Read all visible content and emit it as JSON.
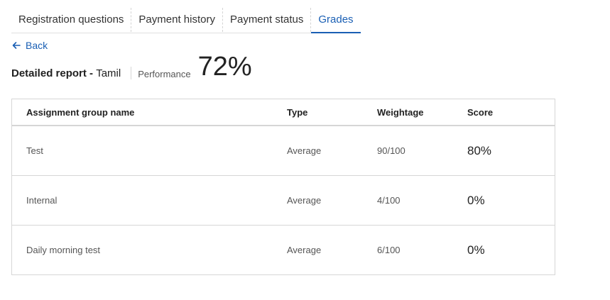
{
  "tabs": [
    {
      "label": "Registration questions"
    },
    {
      "label": "Payment history"
    },
    {
      "label": "Payment status"
    },
    {
      "label": "Grades"
    }
  ],
  "active_tab": "Grades",
  "back_label": "Back",
  "report": {
    "title_prefix": "Detailed report - ",
    "subject": "Tamil",
    "performance_label": "Performance",
    "performance_value": "72%"
  },
  "table": {
    "headers": {
      "name": "Assignment group name",
      "type": "Type",
      "weightage": "Weightage",
      "score": "Score"
    },
    "rows": [
      {
        "name": "Test",
        "type": "Average",
        "weightage": "90/100",
        "score": "80%"
      },
      {
        "name": "Internal",
        "type": "Average",
        "weightage": "4/100",
        "score": "0%"
      },
      {
        "name": "Daily morning test",
        "type": "Average",
        "weightage": "6/100",
        "score": "0%"
      }
    ]
  },
  "colors": {
    "accent": "#1a5fb4",
    "border": "#d6d6d6"
  },
  "icons": {
    "back": "arrow-left-icon"
  }
}
